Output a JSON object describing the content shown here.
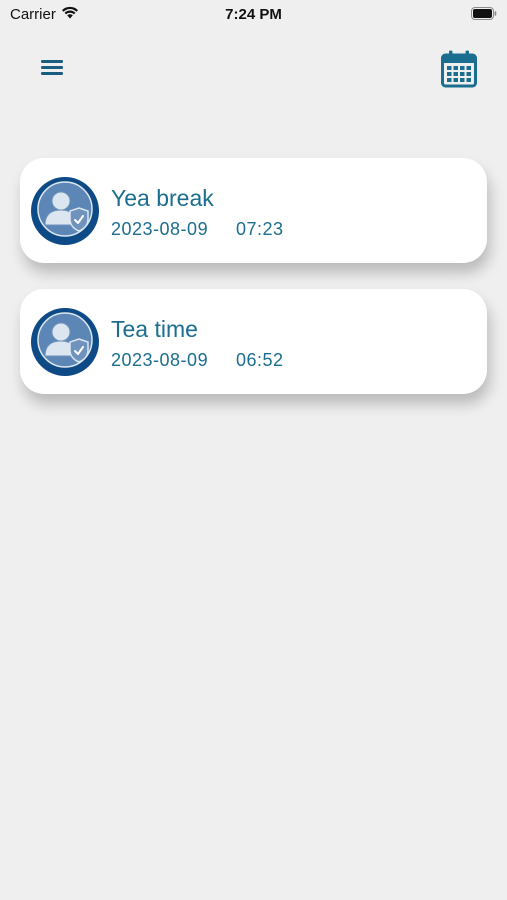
{
  "status_bar": {
    "carrier": "Carrier",
    "time": "7:24 PM",
    "icons": [
      "wifi-icon",
      "battery-icon"
    ]
  },
  "nav": {
    "left_icon": "menu-icon",
    "right_icon": "calendar-icon"
  },
  "colors": {
    "background": "#efefef",
    "accent": "#1b6e8f",
    "avatar_bg": "#0d4a86",
    "card_bg": "#ffffff"
  },
  "entries": [
    {
      "title": "Yea break",
      "date": "2023-08-09",
      "time": "07:23",
      "icon": "user-shield-icon"
    },
    {
      "title": "Tea time",
      "date": "2023-08-09",
      "time": "06:52",
      "icon": "user-shield-icon"
    }
  ]
}
